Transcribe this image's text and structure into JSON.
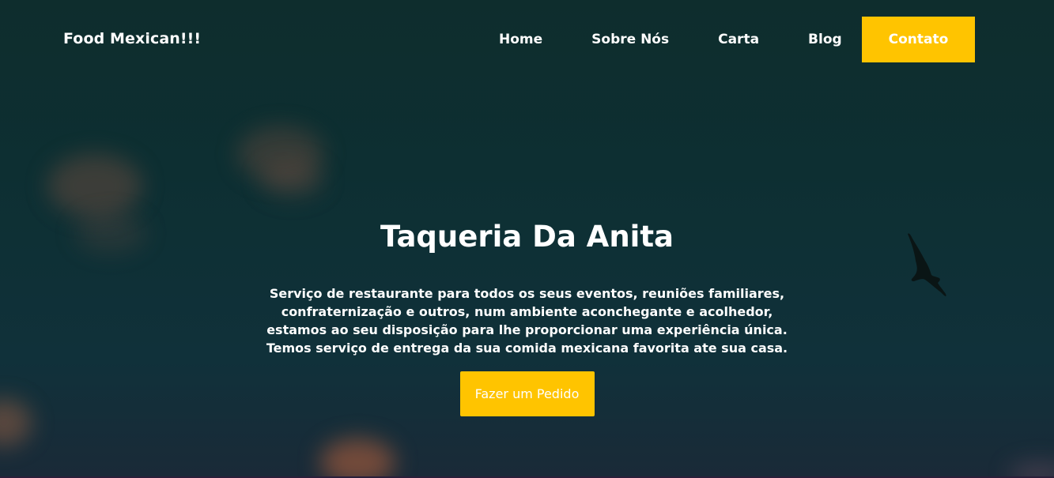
{
  "brand": {
    "name": "Food Mexican!!!"
  },
  "nav": {
    "items": [
      {
        "label": "Home"
      },
      {
        "label": "Sobre Nós"
      },
      {
        "label": "Carta"
      },
      {
        "label": "Blog"
      }
    ],
    "contact_label": "Contato"
  },
  "hero": {
    "title": "Taqueria Da Anita",
    "description": "Serviço de restaurante para todos os seus eventos, reuniões familiares, confraternização e outros, num ambiente aconchegante e acolhedor, estamos ao seu disposição para lhe proporcionar uma experiência única. Temos serviço de entrega da sua comida mexicana favorita ate sua casa.",
    "cta_label": "Fazer um Pedido"
  },
  "decorations": {
    "bird": "bird-silhouette-icon"
  },
  "colors": {
    "accent": "#ffc400",
    "background": "#0e2d2d",
    "text": "#ffffff"
  }
}
